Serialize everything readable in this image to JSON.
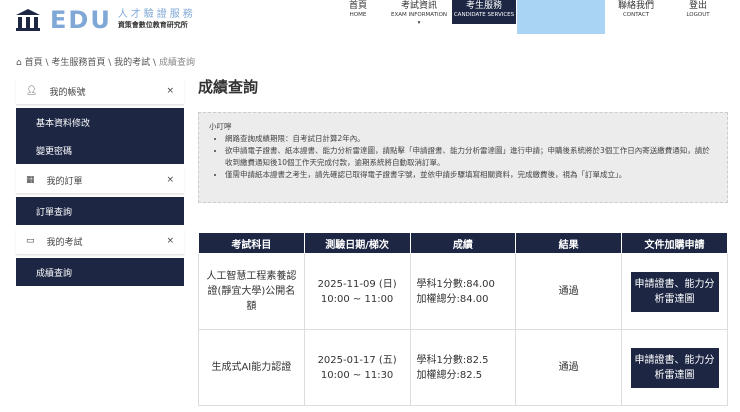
{
  "header": {
    "logo_text": "EDU",
    "org_title": "人才驗證服務",
    "org_subtitle": "資策會數位教育研究所",
    "nav": [
      {
        "zh": "首頁",
        "en": "HOME"
      },
      {
        "zh": "考試資訊",
        "en": "EXAM INFORMATION"
      },
      {
        "zh": "考生服務",
        "en": "CANDIDATE SERVICES"
      },
      {
        "zh": "",
        "en": ""
      },
      {
        "zh": "聯絡我們",
        "en": "CONTACT"
      },
      {
        "zh": "登出",
        "en": "LOGOUT"
      }
    ]
  },
  "breadcrumb": [
    "首頁",
    "考生服務首頁",
    "我的考試",
    "成績查詢"
  ],
  "sidebar": {
    "account": "我的帳號",
    "profile": "基本資料修改",
    "password": "變更密碼",
    "orders": "我的訂單",
    "order_query": "訂單查詢",
    "exams": "我的考試",
    "score_query": "成績查詢"
  },
  "page_title": "成績查詢",
  "notice": {
    "title": "小叮嚀",
    "items": [
      "網路查詢成績期限：自考試日計算2年內。",
      "欲申請電子證書、紙本證書、能力分析雷達圖，請點擊「申請證書、能力分析雷達圖」進行申請；申購後系統將於3個工作日內寄送繳費通知，請於收到繳費通知後10個工作天完成付款，逾期系統將自動取消訂單。",
      "僅需申請紙本證書之考生，請先確認已取得電子證書字號，並依申請步驟填寫相關資料，完成繳費後，視為「訂單成立」。"
    ]
  },
  "table": {
    "headers": [
      "考試科目",
      "測驗日期/梯次",
      "成績",
      "結果",
      "文件加購申請"
    ],
    "rows": [
      {
        "subject": "人工智慧工程素養認證(靜宜大學)公開名額",
        "date": "2025-11-09 (日)",
        "time": "10:00 ~ 11:00",
        "score1": "學科1分數:84.00",
        "score2": "加權總分:84.00",
        "result": "通過",
        "button": "申請證書、能力分析雷達圖"
      },
      {
        "subject": "生成式AI能力認證",
        "date": "2025-01-17 (五)",
        "time": "10:00 ~ 11:30",
        "score1": "學科1分數:82.5",
        "score2": "加權總分:82.5",
        "result": "通過",
        "button": "申請證書、能力分析雷達圖"
      }
    ]
  }
}
